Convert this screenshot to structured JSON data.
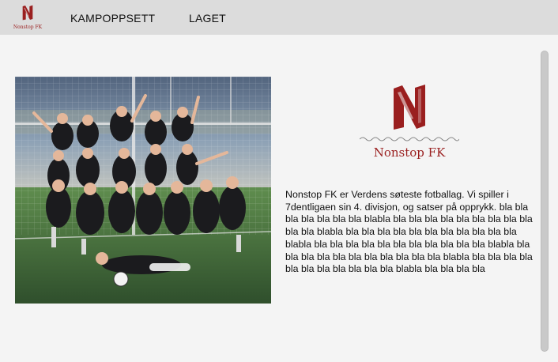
{
  "brand": {
    "name": "Nonstop FK",
    "primary_color": "#9a1f1f",
    "logo_icon": "nonstop-n-logo"
  },
  "nav": {
    "items": [
      {
        "label": "KAMPOPPSETT"
      },
      {
        "label": "LAGET"
      }
    ]
  },
  "hero": {
    "photo_alt": "Team photo",
    "logo_name": "Nonstop FK",
    "intro_text": "Nonstop FK er Verdens søteste fotballag. Vi spiller i 7dentligaen sin 4. divisjon, og satser på opprykk. bla bla bla bla bla bla bla blabla bla bla bla bla bla bla bla bla bla bla bla blabla bla bla bla bla bla bla bla bla bla bla bla blabla bla bla bla bla bla bla bla bla bla bla bla blabla bla bla bla bla bla bla bla bla bla bla bla blabla bla bla bla bla bla bla bla bla bla bla bla blabla bla bla bla bla"
  },
  "colors": {
    "topbar": "#dcdcdc",
    "page": "#f4f4f4",
    "scrollbar": "#c9c9c9"
  }
}
